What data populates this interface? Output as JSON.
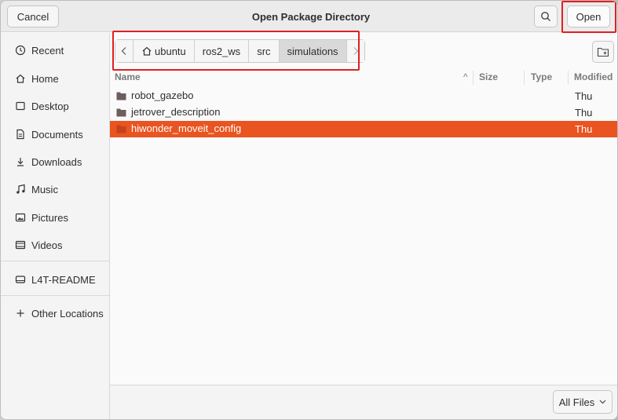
{
  "dialog": {
    "title": "Open Package Directory",
    "cancel_label": "Cancel",
    "open_label": "Open",
    "search_icon": "search-icon"
  },
  "sidebar": {
    "items": [
      {
        "label": "Recent",
        "icon": "clock-icon"
      },
      {
        "label": "Home",
        "icon": "home-icon"
      },
      {
        "label": "Desktop",
        "icon": "desktop-icon"
      },
      {
        "label": "Documents",
        "icon": "document-icon"
      },
      {
        "label": "Downloads",
        "icon": "download-icon"
      },
      {
        "label": "Music",
        "icon": "music-icon"
      },
      {
        "label": "Pictures",
        "icon": "picture-icon"
      },
      {
        "label": "Videos",
        "icon": "video-icon"
      },
      {
        "label": "L4T-README",
        "icon": "drive-icon"
      },
      {
        "label": "Other Locations",
        "icon": "plus-icon"
      }
    ]
  },
  "pathbar": {
    "crumbs": [
      "ubuntu",
      "ros2_ws",
      "src",
      "simulations"
    ],
    "active": "simulations"
  },
  "columns": {
    "name": "Name",
    "size": "Size",
    "type": "Type",
    "modified": "Modified",
    "sort_indicator": "^"
  },
  "files": [
    {
      "name": "robot_gazebo",
      "modified": "Thu",
      "selected": false
    },
    {
      "name": "jetrover_description",
      "modified": "Thu",
      "selected": false
    },
    {
      "name": "hiwonder_moveit_config",
      "modified": "Thu",
      "selected": true
    }
  ],
  "footer": {
    "filter_label": "All Files"
  },
  "colors": {
    "accent": "#e95420",
    "highlight_box": "#e02020"
  }
}
